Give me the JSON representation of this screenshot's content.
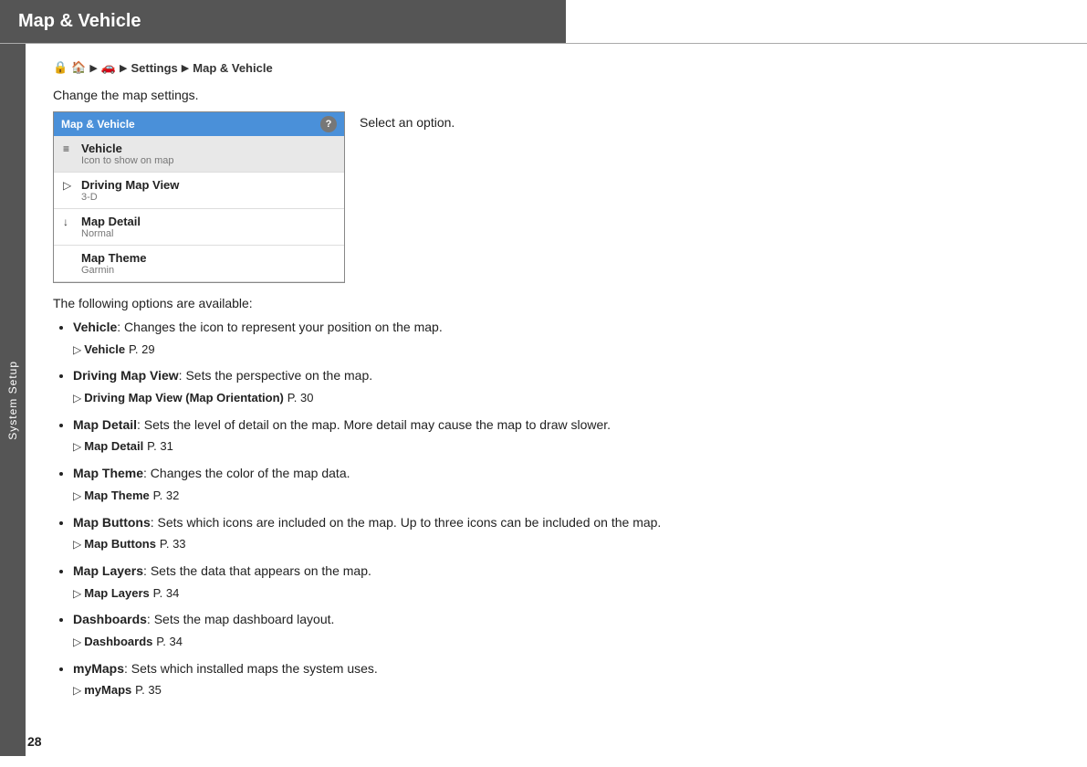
{
  "header": {
    "title": "Map & Vehicle",
    "background_color": "#555555"
  },
  "sidebar": {
    "label": "System Setup"
  },
  "breadcrumb": {
    "icons": [
      "🔒",
      "🏠",
      "▶",
      "🚗",
      "▶"
    ],
    "path": "Settings ▶ Map & Vehicle",
    "settings_label": "Settings",
    "section_label": "Map & Vehicle"
  },
  "intro": {
    "text": "Change the map settings."
  },
  "screenshot": {
    "header_title": "Map & Vehicle",
    "help_label": "?",
    "caption": "Select an option.",
    "menu_items": [
      {
        "icon": "≡",
        "title": "Vehicle",
        "subtitle": "Icon to show on map",
        "has_arrow": false,
        "selected": true
      },
      {
        "icon": "▷",
        "title": "Driving Map View",
        "subtitle": "3-D",
        "has_arrow": false,
        "selected": false
      },
      {
        "icon": "↓",
        "title": "Map Detail",
        "subtitle": "Normal",
        "has_arrow": false,
        "selected": false
      },
      {
        "icon": "",
        "title": "Map Theme",
        "subtitle": "Garmin",
        "has_arrow": false,
        "selected": false
      }
    ]
  },
  "options": {
    "intro": "The following options are available:",
    "items": [
      {
        "title": "Vehicle",
        "desc": ": Changes the icon to represent your position on the map.",
        "ref_text": "Vehicle",
        "ref_page": "P. 29"
      },
      {
        "title": "Driving Map View",
        "desc": ": Sets the perspective on the map.",
        "ref_text": "Driving Map View (Map Orientation)",
        "ref_page": "P. 30"
      },
      {
        "title": "Map Detail",
        "desc": ": Sets the level of detail on the map. More detail may cause the map to draw slower.",
        "ref_text": "Map Detail",
        "ref_page": "P. 31"
      },
      {
        "title": "Map Theme",
        "desc": ": Changes the color of the map data.",
        "ref_text": "Map Theme",
        "ref_page": "P. 32"
      },
      {
        "title": "Map Buttons",
        "desc": ": Sets which icons are included on the map. Up to three icons can be included on the map.",
        "ref_text": "Map Buttons",
        "ref_page": "P. 33"
      },
      {
        "title": "Map Layers",
        "desc": ": Sets the data that appears on the map.",
        "ref_text": "Map Layers",
        "ref_page": "P. 34"
      },
      {
        "title": "Dashboards",
        "desc": ": Sets the map dashboard layout.",
        "ref_text": "Dashboards",
        "ref_page": "P. 34"
      },
      {
        "title": "myMaps",
        "desc": ": Sets which installed maps the system uses.",
        "ref_text": "myMaps",
        "ref_page": "P. 35"
      }
    ]
  },
  "page_number": "28"
}
